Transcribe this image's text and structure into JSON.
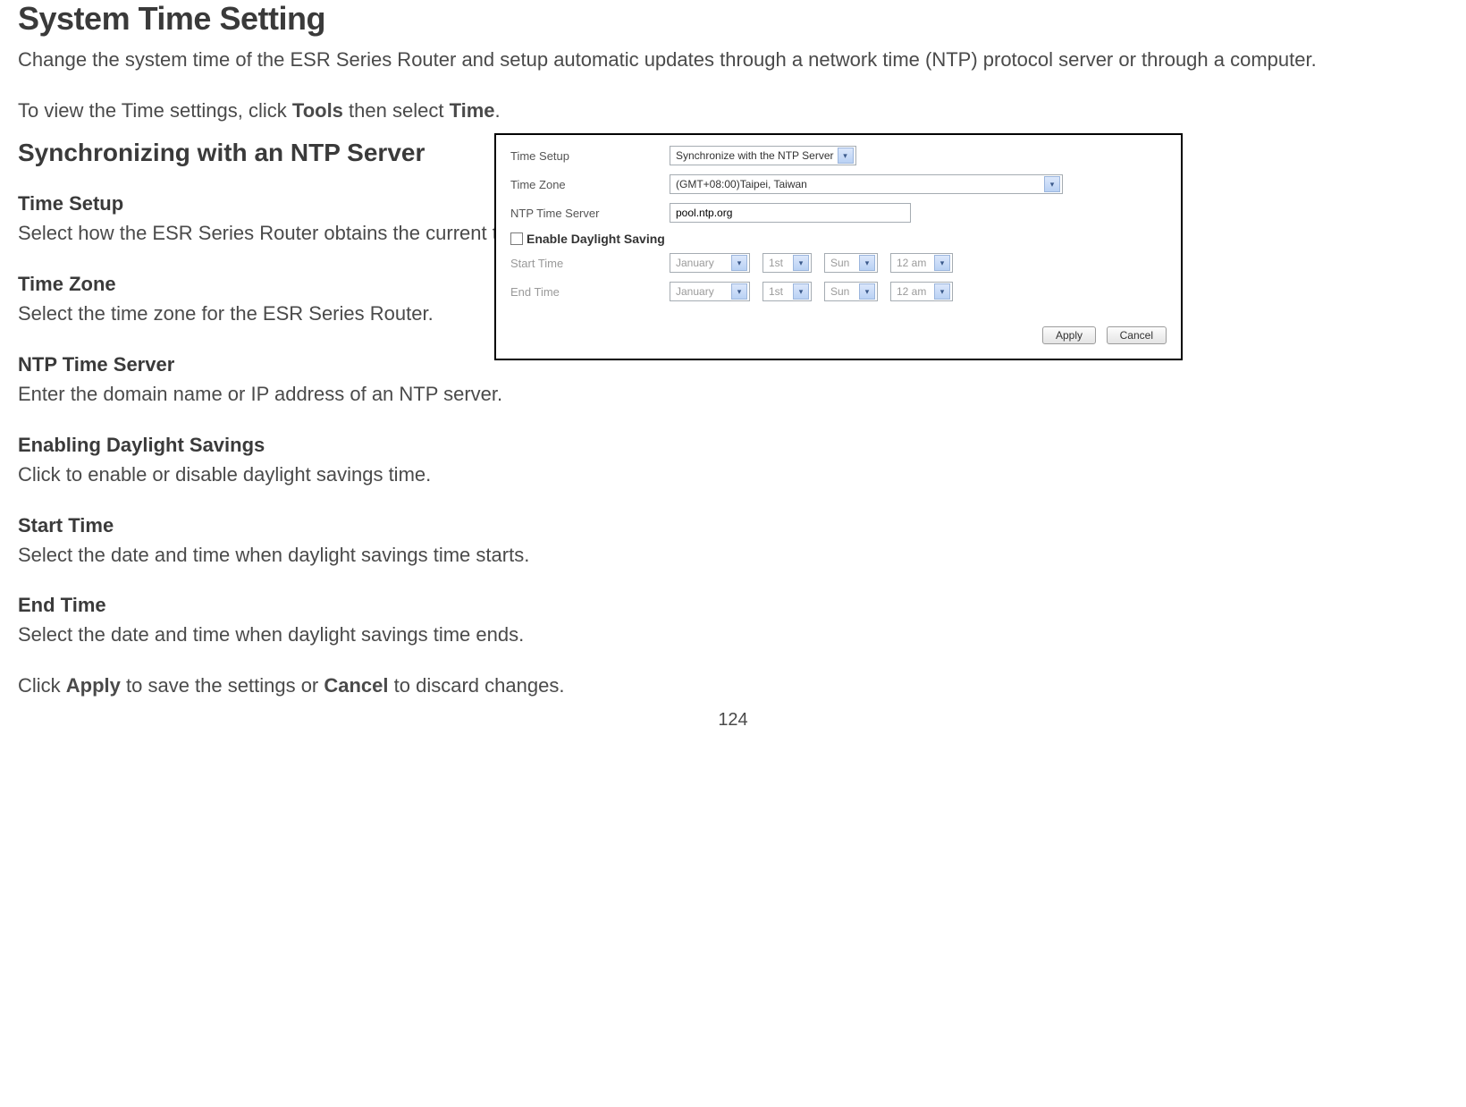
{
  "title": "System Time Setting",
  "intro": "Change the system time of the ESR Series Router and setup automatic updates through a network time (NTP) protocol server or through a computer.",
  "navInstr": {
    "pre": "To view the Time settings, click ",
    "b1": "Tools",
    "mid": " then select ",
    "b2": "Time",
    "post": "."
  },
  "subheading": "Synchronizing with an NTP Server",
  "fields": [
    {
      "title": "Time Setup",
      "desc": "Select how the ESR Series Router obtains the current time."
    },
    {
      "title": "Time Zone",
      "desc": "Select the time zone for the ESR Series Router."
    },
    {
      "title": "NTP Time Server",
      "desc": "Enter the domain name or IP address of an NTP server."
    },
    {
      "title": "Enabling Daylight Savings",
      "desc": "Click to enable or disable daylight savings time."
    },
    {
      "title": "Start Time",
      "desc": "Select the date and time when daylight savings time starts."
    },
    {
      "title": "End Time",
      "desc": "Select the date and time when daylight savings time ends."
    }
  ],
  "bottomInstr": {
    "pre": "Click ",
    "b1": "Apply",
    "mid": " to save the settings or ",
    "b2": "Cancel",
    "post": " to discard changes."
  },
  "pageNumber": "124",
  "panel": {
    "labels": {
      "timeSetup": "Time Setup",
      "timeZone": "Time Zone",
      "ntpServer": "NTP Time Server",
      "dst": "Enable Daylight Saving",
      "startTime": "Start Time",
      "endTime": "End Time"
    },
    "values": {
      "timeSetup": "Synchronize with the NTP Server",
      "timeZone": "(GMT+08:00)Taipei, Taiwan",
      "ntpServer": "pool.ntp.org",
      "dstChecked": false,
      "start": {
        "month": "January",
        "date": "1st",
        "day": "Sun",
        "hour": "12 am"
      },
      "end": {
        "month": "January",
        "date": "1st",
        "day": "Sun",
        "hour": "12 am"
      }
    },
    "buttons": {
      "apply": "Apply",
      "cancel": "Cancel"
    }
  }
}
